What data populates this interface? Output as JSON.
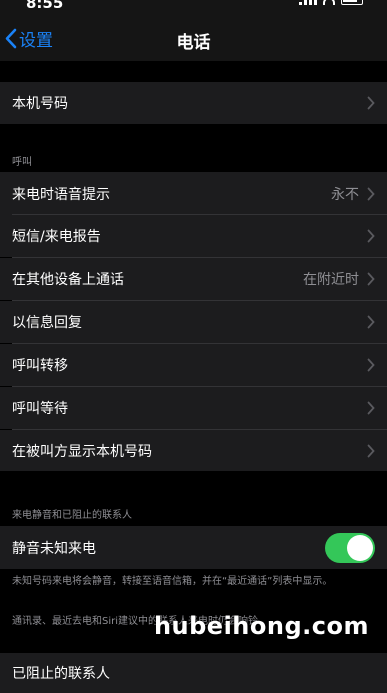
{
  "status": {
    "time": "8:55"
  },
  "nav": {
    "back_label": "设置",
    "title": "电话"
  },
  "rows": {
    "my_number": "本机号码",
    "announce_calls": {
      "label": "来电时语音提示",
      "value": "永不"
    },
    "sms_call_reporting": "短信/来电报告",
    "other_devices": {
      "label": "在其他设备上通话",
      "value": "在附近时"
    },
    "respond_text": "以信息回复",
    "call_forwarding": "呼叫转移",
    "call_waiting": "呼叫等待",
    "show_caller_id": "在被叫方显示本机号码",
    "silence_unknown": "静音未知来电",
    "blocked_contacts": "已阻止的联系人"
  },
  "sections": {
    "calls_header": "呼叫",
    "silence_header": "来电静音和已阻止的联系人",
    "silence_footer_1": "未知号码来电将会静音，转接至语音信箱，并在“最近通话”列表中显示。",
    "silence_footer_2": "通讯录、最近去电和Siri建议中的联系人来电时仍会响铃。"
  },
  "toggles": {
    "silence_unknown_on": true,
    "on_color": "#34c759"
  },
  "accent_color": "#1a82f7",
  "watermark": "hubeihong.com"
}
